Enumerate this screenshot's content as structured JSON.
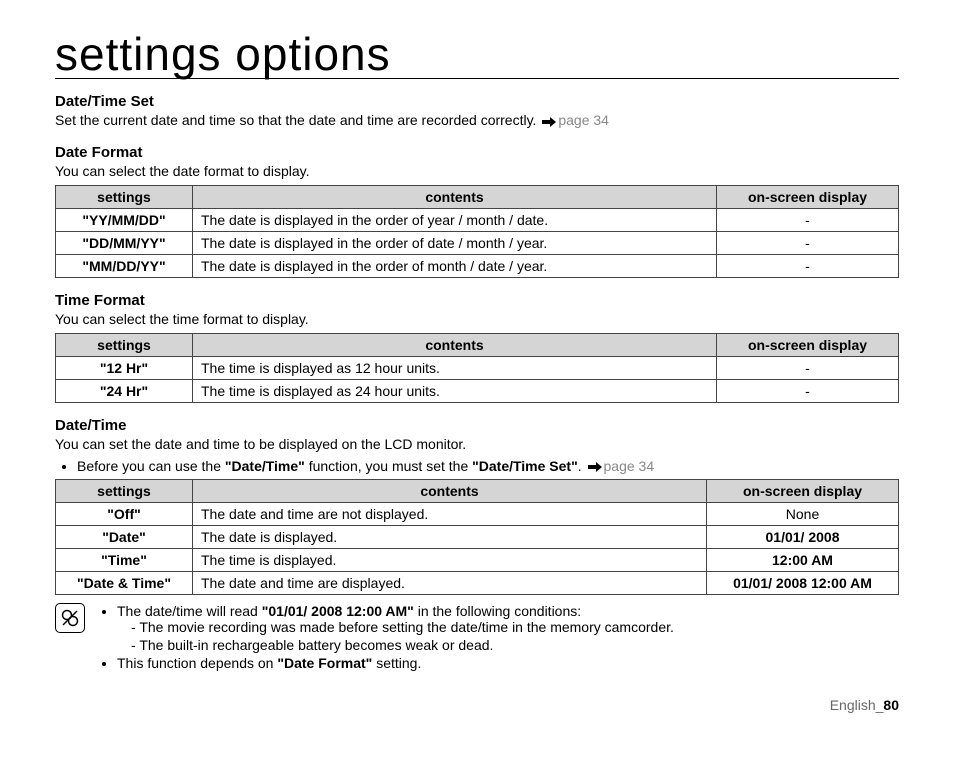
{
  "title": "settings options",
  "headers": {
    "settings": "settings",
    "contents": "contents",
    "osd": "on-screen display"
  },
  "sections": {
    "datetimeset": {
      "title": "Date/Time Set",
      "text_pre": "Set the current date and time so that the date and time are recorded correctly. ",
      "pageref": "page 34"
    },
    "dateformat": {
      "title": "Date Format",
      "text": "You can select the date format to display.",
      "rows": [
        {
          "setting": "\"YY/MM/DD\"",
          "content": "The date is displayed in the order of year / month / date.",
          "osd": "-"
        },
        {
          "setting": "\"DD/MM/YY\"",
          "content": "The date is displayed in the order of date / month / year.",
          "osd": "-"
        },
        {
          "setting": "\"MM/DD/YY\"",
          "content": "The date is displayed in the order of month / date / year.",
          "osd": "-"
        }
      ]
    },
    "timeformat": {
      "title": "Time Format",
      "text": "You can select the time format to display.",
      "rows": [
        {
          "setting": "\"12 Hr\"",
          "content": "The time is displayed as 12 hour units.",
          "osd": "-"
        },
        {
          "setting": "\"24 Hr\"",
          "content": "The time is displayed as 24 hour units.",
          "osd": "-"
        }
      ]
    },
    "datetime": {
      "title": "Date/Time",
      "text": "You can set the date and time to be displayed on the LCD monitor.",
      "bullet_pre1": "Before you can use the ",
      "bullet_b1": "\"Date/Time\"",
      "bullet_mid": " function, you must set the ",
      "bullet_b2": "\"Date/Time Set\"",
      "bullet_post": ". ",
      "pageref": "page 34",
      "rows": [
        {
          "setting": "\"Off\"",
          "content": "The date and time are not displayed.",
          "osd": "None",
          "osd_bold": false
        },
        {
          "setting": "\"Date\"",
          "content": "The date is displayed.",
          "osd": "01/01/ 2008",
          "osd_bold": true
        },
        {
          "setting": "\"Time\"",
          "content": "The time is displayed.",
          "osd": "12:00 AM",
          "osd_bold": true
        },
        {
          "setting": "\"Date & Time\"",
          "content": "The date and time are displayed.",
          "osd": "01/01/ 2008 12:00 AM",
          "osd_bold": true
        }
      ]
    }
  },
  "note": {
    "line1_pre": "The date/time will read ",
    "line1_b": "\"01/01/ 2008 12:00 AM\"",
    "line1_post": " in the following conditions:",
    "sub1": "The movie recording was made before setting the date/time in the memory camcorder.",
    "sub2": "The built-in rechargeable battery becomes weak or dead.",
    "line2_pre": "This function depends on ",
    "line2_b": "\"Date Format\"",
    "line2_post": " setting."
  },
  "footer": {
    "lang": "English",
    "sep": "_",
    "page": "80"
  }
}
